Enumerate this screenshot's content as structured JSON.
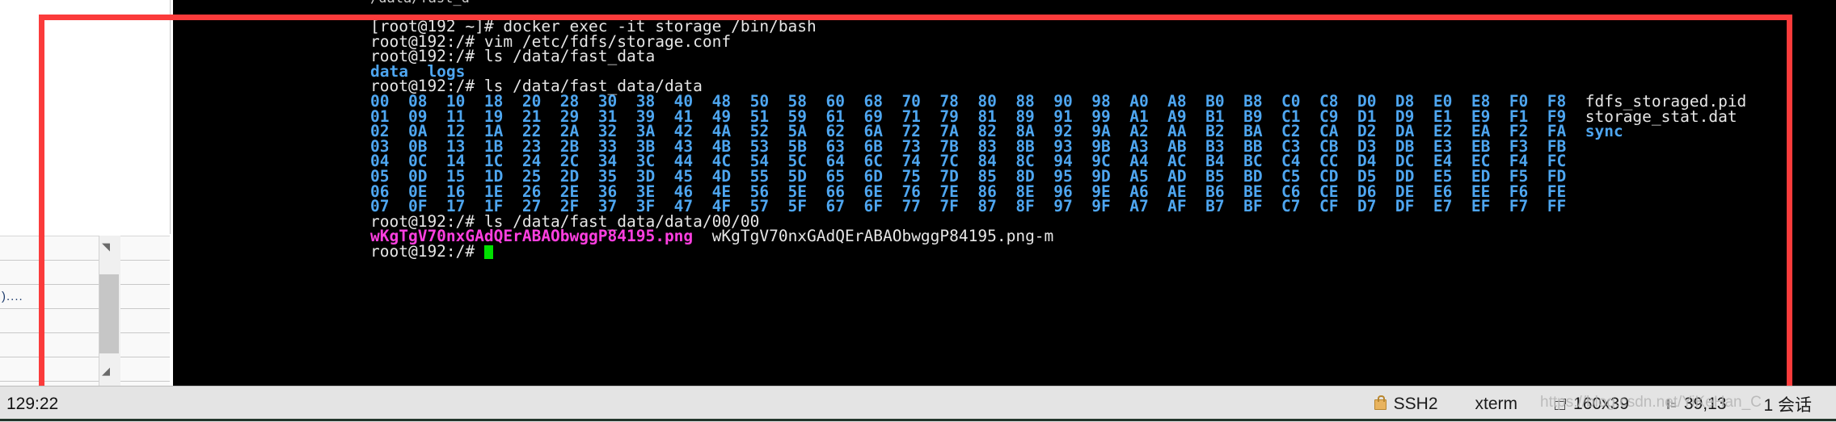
{
  "window": {
    "title_strip_text": "/data/fast_d"
  },
  "terminal": {
    "prompt_host": "root@192",
    "lines": [
      {
        "id": "cmd-docker-exec",
        "segments": [
          {
            "text": "[root@192 ~]# docker exec -it storage /bin/bash",
            "style": "w"
          }
        ]
      },
      {
        "id": "cmd-vim-storage-conf",
        "segments": [
          {
            "text": "root@192:/# vim /etc/fdfs/storage.conf",
            "style": "w"
          }
        ]
      },
      {
        "id": "cmd-ls-fast-data",
        "segments": [
          {
            "text": "root@192:/# ls /data/fast_data",
            "style": "w"
          }
        ]
      },
      {
        "id": "out-fast-data-listing",
        "segments": [
          {
            "text": "data  logs",
            "style": "b"
          }
        ]
      },
      {
        "id": "cmd-ls-fast-data-data",
        "segments": [
          {
            "text": "root@192:/# ls /data/fast_data/data",
            "style": "w"
          }
        ]
      },
      {
        "id": "out-hex-row-0",
        "segments": [
          {
            "text": "00  08  10  18  20  28  30  38  40  48  50  58  60  68  70  78  80  88  90  98  A0  A8  B0  B8  C0  C8  D0  D8  E0  E8  F0  F8  ",
            "style": "b"
          },
          {
            "text": "fdfs_storaged.pid",
            "style": "w"
          }
        ]
      },
      {
        "id": "out-hex-row-1",
        "segments": [
          {
            "text": "01  09  11  19  21  29  31  39  41  49  51  59  61  69  71  79  81  89  91  99  A1  A9  B1  B9  C1  C9  D1  D9  E1  E9  F1  F9  ",
            "style": "b"
          },
          {
            "text": "storage_stat.dat",
            "style": "w"
          }
        ]
      },
      {
        "id": "out-hex-row-2",
        "segments": [
          {
            "text": "02  0A  12  1A  22  2A  32  3A  42  4A  52  5A  62  6A  72  7A  82  8A  92  9A  A2  AA  B2  BA  C2  CA  D2  DA  E2  EA  F2  FA  ",
            "style": "b"
          },
          {
            "text": "sync",
            "style": "b"
          }
        ]
      },
      {
        "id": "out-hex-row-3",
        "segments": [
          {
            "text": "03  0B  13  1B  23  2B  33  3B  43  4B  53  5B  63  6B  73  7B  83  8B  93  9B  A3  AB  B3  BB  C3  CB  D3  DB  E3  EB  F3  FB",
            "style": "b"
          }
        ]
      },
      {
        "id": "out-hex-row-4",
        "segments": [
          {
            "text": "04  0C  14  1C  24  2C  34  3C  44  4C  54  5C  64  6C  74  7C  84  8C  94  9C  A4  AC  B4  BC  C4  CC  D4  DC  E4  EC  F4  FC",
            "style": "b"
          }
        ]
      },
      {
        "id": "out-hex-row-5",
        "segments": [
          {
            "text": "05  0D  15  1D  25  2D  35  3D  45  4D  55  5D  65  6D  75  7D  85  8D  95  9D  A5  AD  B5  BD  C5  CD  D5  DD  E5  ED  F5  FD",
            "style": "b"
          }
        ]
      },
      {
        "id": "out-hex-row-6",
        "segments": [
          {
            "text": "06  0E  16  1E  26  2E  36  3E  46  4E  56  5E  66  6E  76  7E  86  8E  96  9E  A6  AE  B6  BE  C6  CE  D6  DE  E6  EE  F6  FE",
            "style": "b"
          }
        ]
      },
      {
        "id": "out-hex-row-7",
        "segments": [
          {
            "text": "07  0F  17  1F  27  2F  37  3F  47  4F  57  5F  67  6F  77  7F  87  8F  97  9F  A7  AF  B7  BF  C7  CF  D7  DF  E7  EF  F7  FF",
            "style": "b"
          }
        ]
      },
      {
        "id": "cmd-ls-00-00",
        "segments": [
          {
            "text": "root@192:/# ls /data/fast_data/data/00/00",
            "style": "w"
          }
        ]
      },
      {
        "id": "out-00-00-listing",
        "segments": [
          {
            "text": "wKgTgV70nxGAdQErABAObwggP84195.png",
            "style": "m"
          },
          {
            "text": "  wKgTgV70nxGAdQErABAObwggP84195.png-m",
            "style": "w"
          }
        ]
      },
      {
        "id": "prompt-final",
        "segments": [
          {
            "text": "root@192:/# ",
            "style": "w"
          }
        ],
        "cursor": true
      }
    ]
  },
  "background_panel": {
    "rows": [
      {
        "text": ""
      },
      {
        "text": ""
      },
      {
        "text": ")...."
      },
      {
        "text": ""
      },
      {
        "text": ""
      },
      {
        "text": ""
      },
      {
        "text": ""
      }
    ]
  },
  "statusbar": {
    "left_text": "129:22",
    "items": [
      {
        "icon": "lock-icon",
        "label": "SSH2"
      },
      {
        "icon": null,
        "label": "xterm"
      },
      {
        "icon": "terminal-size-icon",
        "label": "160x39"
      },
      {
        "icon": "cursor-position-icon",
        "label": "39,13"
      },
      {
        "icon": null,
        "label": "1 会话"
      }
    ]
  },
  "watermark": {
    "text": "https://blog.csdn.net/YiKeHan_C"
  },
  "colors": {
    "terminal_bg": "#000000",
    "terminal_fg": "#e6e6e6",
    "dir_blue": "#4ea6f0",
    "image_magenta": "#ff3fe0",
    "cursor_green": "#00e000",
    "annotation_red": "#fb3b3b",
    "statusbar_bg": "#e4e4e4"
  }
}
